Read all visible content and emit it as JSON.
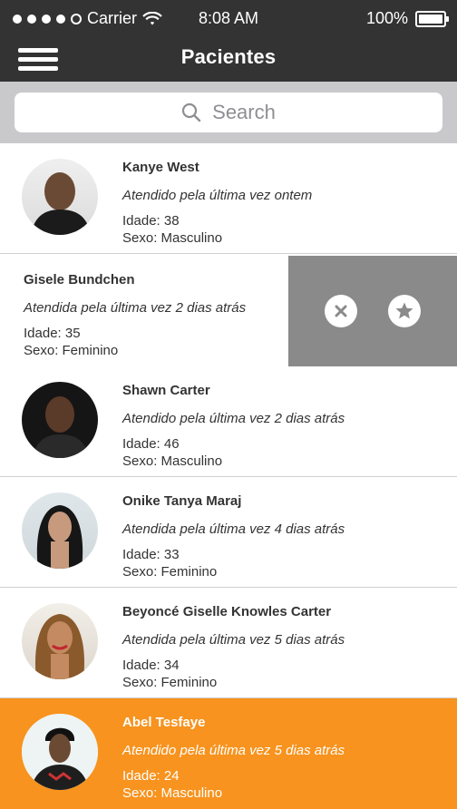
{
  "status_bar": {
    "carrier": "Carrier",
    "time": "8:08 AM",
    "battery": "100%"
  },
  "navbar": {
    "title": "Pacientes"
  },
  "search": {
    "placeholder": "Search"
  },
  "patients": [
    {
      "name": "Kanye West",
      "last_seen": "Atendido pela última vez ontem",
      "age": "Idade: 38",
      "sex": "Sexo: Masculino"
    },
    {
      "name": "Gisele Bundchen",
      "last_seen": "Atendida pela última vez 2 dias atrás",
      "age": "Idade: 35",
      "sex": "Sexo: Feminino"
    },
    {
      "name": "Shawn Carter",
      "last_seen": "Atendido pela última vez 2 dias atrás",
      "age": "Idade: 46",
      "sex": "Sexo: Masculino"
    },
    {
      "name": "Onike Tanya Maraj",
      "last_seen": "Atendida pela última vez 4 dias atrás",
      "age": "Idade: 33",
      "sex": "Sexo: Feminino"
    },
    {
      "name": "Beyoncé Giselle Knowles Carter",
      "last_seen": "Atendida pela última vez 5 dias atrás",
      "age": "Idade: 34",
      "sex": "Sexo: Feminino"
    },
    {
      "name": "Abel Tesfaye",
      "last_seen": "Atendido pela última vez 5 dias atrás",
      "age": "Idade: 24",
      "sex": "Sexo: Masculino"
    }
  ],
  "swipe_actions": {
    "delete_icon": "close-icon",
    "favorite_icon": "star-icon"
  },
  "colors": {
    "header_bg": "#333333",
    "selected_row": "#F7931E",
    "swipe_bg": "#8a8a8a"
  }
}
